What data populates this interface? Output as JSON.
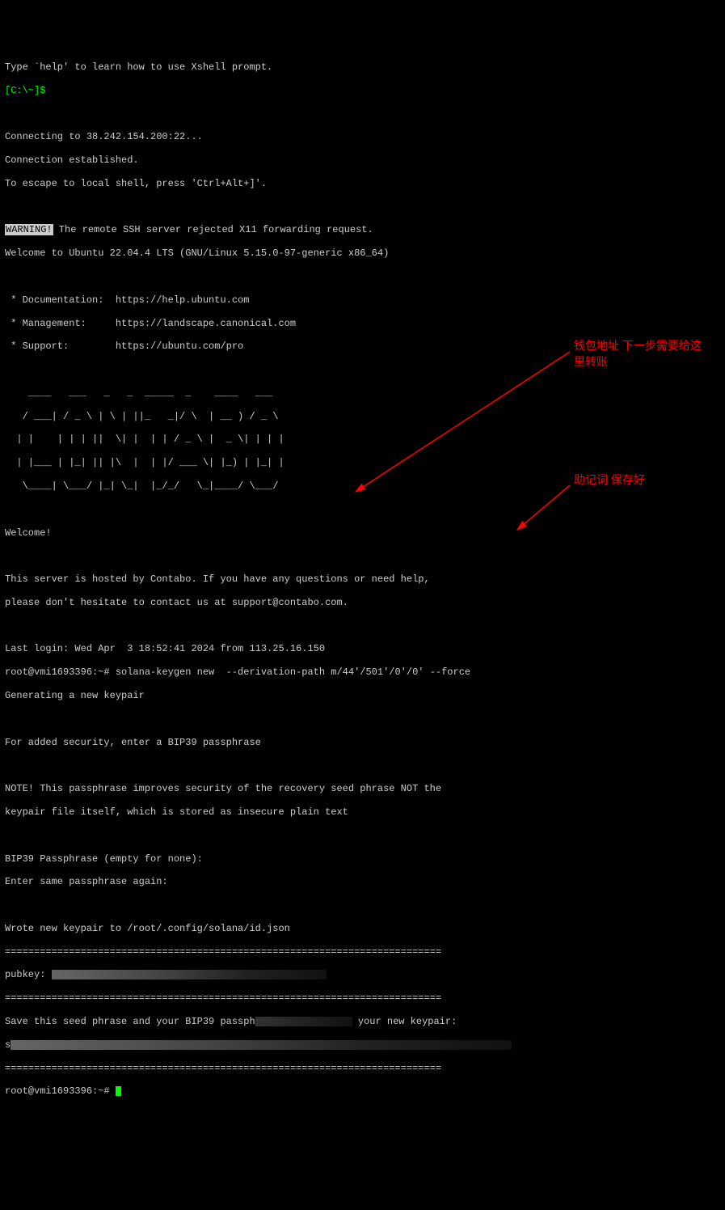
{
  "intro": {
    "help_line": "Type `help' to learn how to use Xshell prompt.",
    "prompt_local": "[C:\\~]$",
    "connecting": "Connecting to 38.242.154.200:22...",
    "established": "Connection established.",
    "escape": "To escape to local shell, press 'Ctrl+Alt+]'."
  },
  "warning": {
    "label": "WARNING!",
    "text": " The remote SSH server rejected X11 forwarding request."
  },
  "welcome_line": "Welcome to Ubuntu 22.04.4 LTS (GNU/Linux 5.15.0-97-generic x86_64)",
  "links": {
    "doc": " * Documentation:  https://help.ubuntu.com",
    "mgmt": " * Management:     https://landscape.canonical.com",
    "sup": " * Support:        https://ubuntu.com/pro"
  },
  "ascii": [
    "    ____   ___   _   _  _____  _    ____   ___  ",
    "   / ___| / _ \\ | \\ | ||_   _|/ \\  | __ ) / _ \\ ",
    "  | |    | | | ||  \\| |  | | / _ \\ |  _ \\| | | |",
    "  | |___ | |_| || |\\  |  | |/ ___ \\| |_) | |_| |",
    "   \\____| \\___/ |_| \\_|  |_/_/   \\_|____/ \\___/ "
  ],
  "motd": {
    "welcome": "Welcome!",
    "hosted1": "This server is hosted by Contabo. If you have any questions or need help,",
    "hosted2": "please don't hesitate to contact us at support@contabo.com."
  },
  "lastlogin": "Last login: Wed Apr  3 18:52:41 2024 from 113.25.16.150",
  "keygen": {
    "prompt_host": "root@vmi1693396:~# ",
    "cmd": "solana-keygen new  --derivation-path m/44'/501'/0'/0' --force",
    "gen": "Generating a new keypair",
    "sec": "For added security, enter a BIP39 passphrase",
    "note1": "NOTE! This passphrase improves security of the recovery seed phrase NOT the",
    "note2": "keypair file itself, which is stored as insecure plain text",
    "bip39_prompt": "BIP39 Passphrase (empty for none):",
    "bip39_again": "Enter same passphrase again:",
    "wrote": "Wrote new keypair to /root/.config/solana/id.json",
    "divider": "===========================================================================",
    "pubkey_label": "pubkey: ",
    "save_line_a": "Save this seed phrase and your BIP39 passph",
    "save_line_b": " your new keypair:",
    "seed_prefix": "s",
    "final_prompt": "root@vmi1693396:~# "
  },
  "annotations": {
    "wallet": "钱包地址\n下一步需要给这里转账",
    "mnemonic": "助记词\n保存好"
  }
}
